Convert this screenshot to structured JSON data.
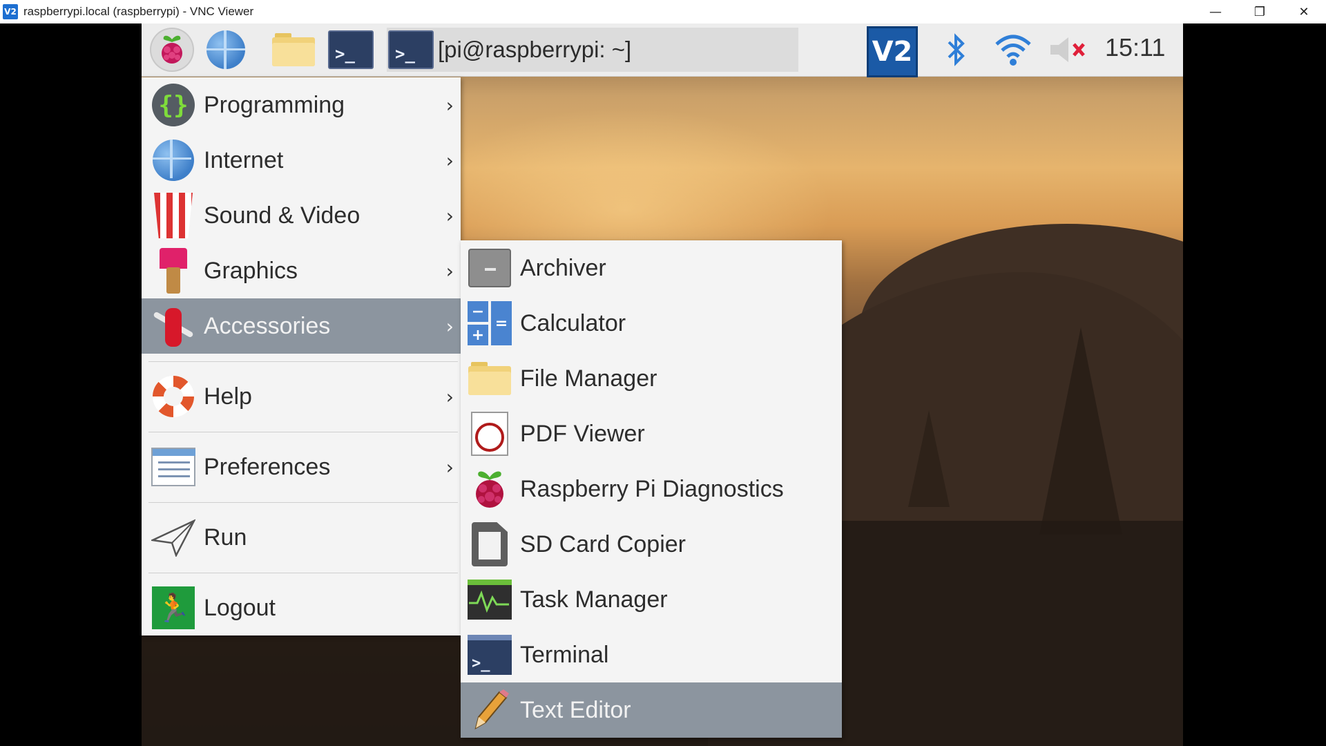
{
  "window": {
    "badge": "V2",
    "title": "raspberrypi.local (raspberrypi) - VNC Viewer",
    "minimize": "—",
    "restore": "❐",
    "close": "✕"
  },
  "panel": {
    "task_label": "[pi@raspberrypi: ~]",
    "vnc_tray": "V2",
    "clock": "15:11",
    "term_prompt": ">_"
  },
  "menu": {
    "items": [
      {
        "label": "Programming",
        "icon": "braces-icon",
        "submenu": true
      },
      {
        "label": "Internet",
        "icon": "globe-icon",
        "submenu": true
      },
      {
        "label": "Sound & Video",
        "icon": "popcorn-icon",
        "submenu": true
      },
      {
        "label": "Graphics",
        "icon": "paintbrush-icon",
        "submenu": true
      },
      {
        "label": "Accessories",
        "icon": "swiss-knife-icon",
        "submenu": true,
        "selected": true
      },
      {
        "label": "Help",
        "icon": "lifebuoy-icon",
        "submenu": true
      },
      {
        "label": "Preferences",
        "icon": "settings-panel-icon",
        "submenu": true
      },
      {
        "label": "Run",
        "icon": "paper-plane-icon",
        "submenu": false
      },
      {
        "label": "Logout",
        "icon": "exit-icon",
        "submenu": false
      }
    ],
    "arrow": "›"
  },
  "submenu": {
    "items": [
      {
        "label": "Archiver",
        "icon": "archive-box-icon"
      },
      {
        "label": "Calculator",
        "icon": "calculator-icon"
      },
      {
        "label": "File Manager",
        "icon": "folder-icon"
      },
      {
        "label": "PDF Viewer",
        "icon": "pdf-magnifier-icon"
      },
      {
        "label": "Raspberry Pi Diagnostics",
        "icon": "raspberry-icon"
      },
      {
        "label": "SD Card Copier",
        "icon": "sd-card-icon"
      },
      {
        "label": "Task Manager",
        "icon": "task-monitor-icon"
      },
      {
        "label": "Terminal",
        "icon": "terminal-icon"
      },
      {
        "label": "Text Editor",
        "icon": "pencil-icon",
        "selected": true
      }
    ]
  },
  "colors": {
    "menu_bg": "#f4f4f4",
    "selected_bg": "#8c959f",
    "panel_bg": "#ededed",
    "vnc_blue": "#1b5aa6"
  }
}
